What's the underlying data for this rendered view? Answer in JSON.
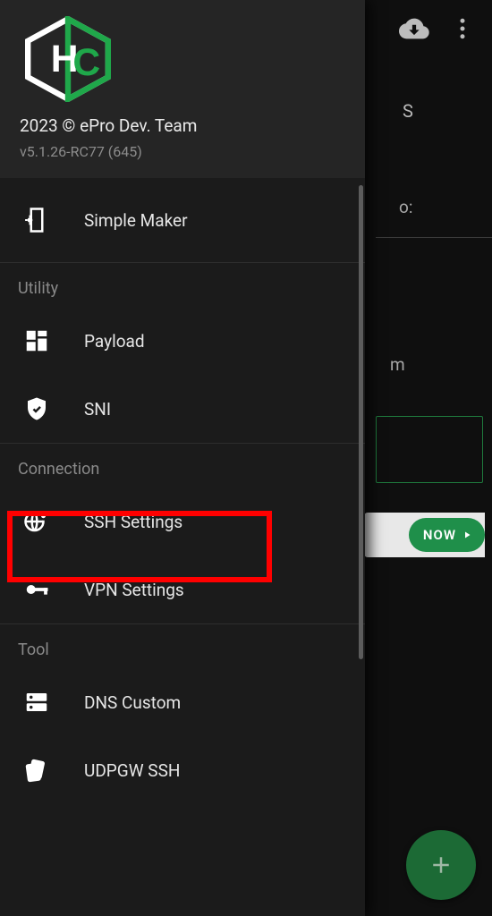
{
  "topbar": {
    "download_icon": "cloud-download",
    "more_icon": "more-vert"
  },
  "background": {
    "t1": "S",
    "t2": "o:",
    "t3": "m",
    "now_label": "NOW"
  },
  "fab": {
    "plus": "+"
  },
  "drawer": {
    "copyright": "2023 © ePro Dev. Team",
    "version": "v5.1.26-RC77 (645)",
    "simple_maker": "Simple Maker",
    "section_utility": "Utility",
    "payload": "Payload",
    "sni": "SNI",
    "section_connection": "Connection",
    "ssh_settings": "SSH Settings",
    "vpn_settings": "VPN Settings",
    "section_tool": "Tool",
    "dns_custom": "DNS Custom",
    "udpgw_ssh": "UDPGW SSH"
  }
}
